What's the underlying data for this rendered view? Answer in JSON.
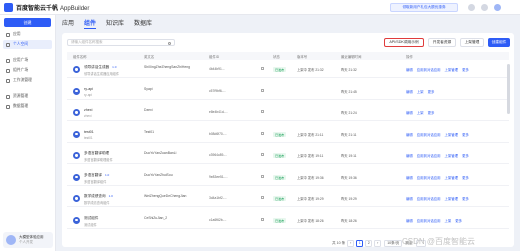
{
  "app": {
    "brand": "百度智能云千帆",
    "product": "AppBuilder",
    "top_button": "领取新用户礼包大额优惠券"
  },
  "sidebar": {
    "create": "创建",
    "items": [
      {
        "label": "应用"
      },
      {
        "label": "个人空间"
      },
      {
        "label": "应用广场"
      },
      {
        "label": "组件广场"
      },
      {
        "label": "工作流管理"
      },
      {
        "label": "资源管理"
      },
      {
        "label": "数据管理"
      }
    ],
    "user_name": "大模型体验应用",
    "user_role": "个人开发"
  },
  "tabs": [
    "应用",
    "组件",
    "知识库",
    "数据库"
  ],
  "search": {
    "placeholder": "请输入组件名称搜索"
  },
  "buttons": {
    "highlight": "API/SDK调用示例",
    "b2": "开发者资源",
    "b3": "上架管理",
    "create": "创建组件"
  },
  "columns": [
    "组件名称",
    "英文名",
    "组件ID",
    "状态",
    "版本号",
    "最近编辑时间",
    "操作"
  ],
  "rows": [
    {
      "name": "领导讲话生成器",
      "tag": "1.0",
      "desc": "领导讲话生成器应用组件",
      "en": "ShiXingZheZhengSanZhiHeng",
      "id": "4b44b91...",
      "status": "已发布",
      "ver": "上架中 发布 21:32",
      "time": "昨天 21:32",
      "ops": [
        "编辑",
        "应用到对话应用",
        "上架管理",
        "更多"
      ]
    },
    {
      "name": "ry-api",
      "tag": "",
      "desc": "ry-api",
      "en": "Syapi",
      "id": "c57f9bf6-...",
      "status": "",
      "ver": "",
      "time": "昨天 21:45",
      "ops": [
        "编辑",
        "",
        "上架",
        "更多"
      ]
    },
    {
      "name": "zhexi",
      "tag": "",
      "desc": "zhexi",
      "en": "Dzexi",
      "id": "e8e4b41d-...",
      "status": "",
      "ver": "",
      "time": "昨天 21:24",
      "ops": [
        "编辑",
        "",
        "上架",
        "更多"
      ]
    },
    {
      "name": "test01",
      "tag": "",
      "desc": "test01",
      "en": "Test01",
      "id": "b08d6f70-...",
      "status": "已发布",
      "ver": "上架中 发布 21:11",
      "time": "昨天 21:11",
      "ops": [
        "编辑",
        "应用到对话应用",
        "上架管理",
        "更多"
      ]
    },
    {
      "name": "多语言翻译助理",
      "tag": "",
      "desc": "多语言翻译助理组件",
      "en": "DuoYuYanZuanBanLi",
      "id": "c3964c89-...",
      "status": "已发布",
      "ver": "上架中 发布 19:11",
      "time": "昨天 19:11",
      "ops": [
        "编辑",
        "应用到对话应用",
        "上架管理",
        "更多"
      ]
    },
    {
      "name": "多语言翻译",
      "tag": "1.0",
      "desc": "多语言翻译组件",
      "en": "DuoYuYanZhuiSou",
      "id": "9e83ee51-...",
      "status": "已发布",
      "ver": "上架中 发布 19:36",
      "time": "昨天 19:36",
      "ops": [
        "编辑",
        "应用到对话应用",
        "上架管理",
        "更多"
      ]
    },
    {
      "name": "数学成绩查询",
      "tag": "1.0",
      "desc": "数学成绩查询组件",
      "en": "WeiZhengQueDeChengJian",
      "id": "3d4a1bf2-...",
      "status": "已发布",
      "ver": "上架中 发布 19:29",
      "time": "昨天 19:29",
      "ops": [
        "编辑",
        "应用到对话应用",
        "上架管理",
        "更多"
      ]
    },
    {
      "name": "测试组件",
      "tag": "",
      "desc": "测试组件",
      "en": "CeShiZuJian_2",
      "id": "c1a6f62b-...",
      "status": "已发布",
      "ver": "上架中 发布 18:26",
      "time": "昨天 18:26",
      "ops": [
        "编辑",
        "应用到对话应用",
        "上架",
        "更多"
      ]
    }
  ],
  "pager": {
    "total": "共 10 条",
    "pages": [
      "1",
      "2"
    ],
    "size": "10条/页",
    "jump": "跳至"
  },
  "watermark": "CSDN @百度智能云"
}
